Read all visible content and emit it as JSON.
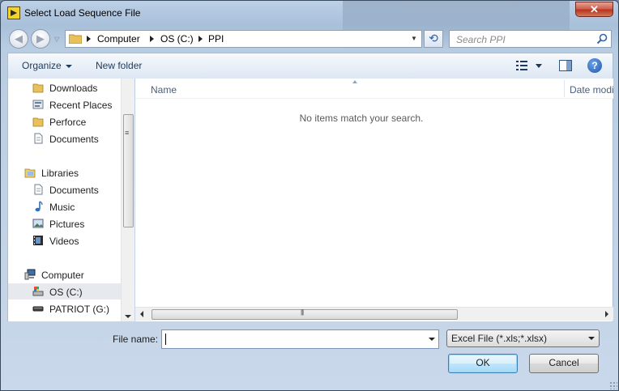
{
  "window": {
    "title": "Select Load Sequence File",
    "close_glyph": "✕"
  },
  "navigation": {
    "back_glyph": "◀",
    "forward_glyph": "▶",
    "breadcrumb": [
      "Computer",
      "OS (C:)",
      "PPI"
    ],
    "refresh_glyph": "⟲",
    "search_placeholder": "Search PPI"
  },
  "toolbar": {
    "organize_label": "Organize",
    "new_folder_label": "New folder",
    "help_glyph": "?"
  },
  "nav_pane": {
    "items": [
      {
        "label": "Downloads",
        "icon": "folder-icon"
      },
      {
        "label": "Recent Places",
        "icon": "recent-places-icon"
      },
      {
        "label": "Perforce",
        "icon": "folder-icon"
      },
      {
        "label": "Documents",
        "icon": "document-icon"
      },
      {
        "label": "Libraries",
        "icon": "libraries-icon"
      },
      {
        "label": "Documents",
        "icon": "document-icon"
      },
      {
        "label": "Music",
        "icon": "music-icon"
      },
      {
        "label": "Pictures",
        "icon": "pictures-icon"
      },
      {
        "label": "Videos",
        "icon": "videos-icon"
      },
      {
        "label": "Computer",
        "icon": "computer-icon"
      },
      {
        "label": "OS (C:)",
        "icon": "drive-icon",
        "selected": true
      },
      {
        "label": "PATRIOT (G:)",
        "icon": "usb-drive-icon"
      }
    ]
  },
  "file_list": {
    "columns": [
      "Name",
      "Date modi"
    ],
    "empty_message": "No items match your search.",
    "scroll_grip": "|||"
  },
  "footer": {
    "file_name_label": "File name:",
    "file_name_value": "",
    "file_type_selected": "Excel File (*.xls;*.xlsx)",
    "ok_label": "OK",
    "cancel_label": "Cancel"
  },
  "colors": {
    "accent": "#1e395b",
    "selection": "#e6e9ee",
    "close_button": "#c7462e"
  }
}
